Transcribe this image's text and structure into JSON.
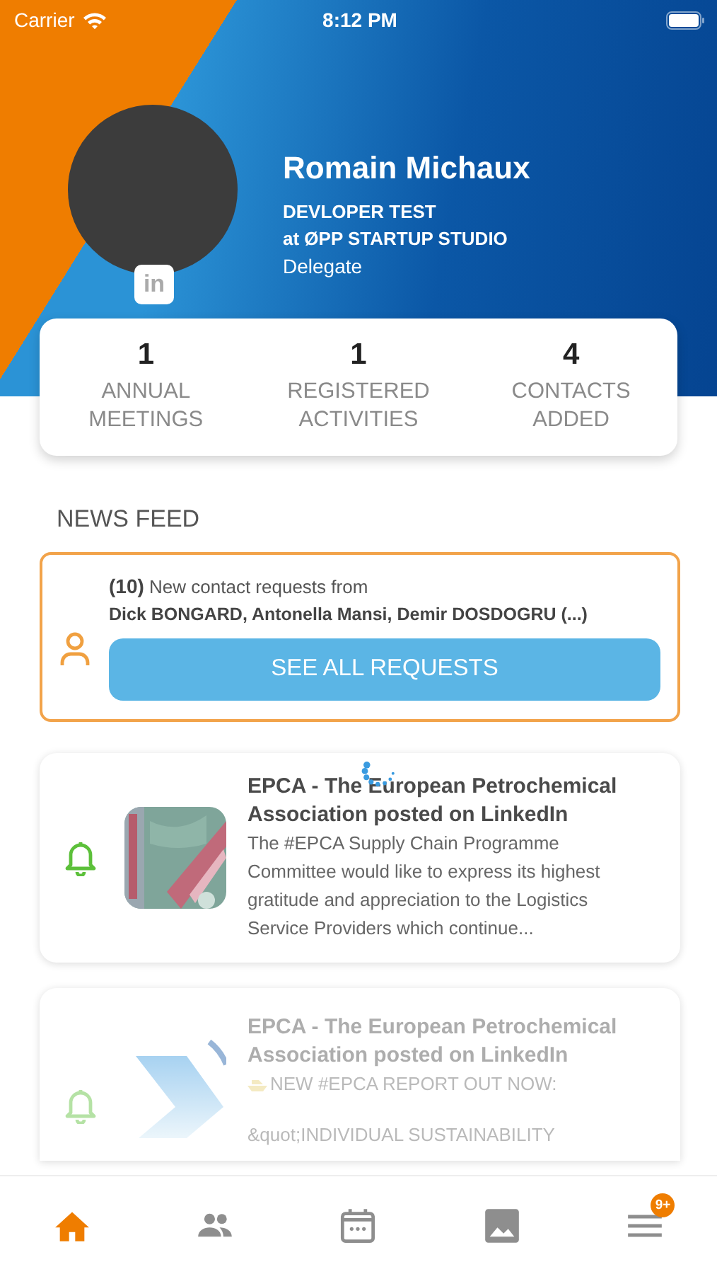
{
  "status_bar": {
    "carrier": "Carrier",
    "time": "8:12 PM"
  },
  "profile": {
    "name": "Romain Michaux",
    "job_title": "DEVLOPER TEST",
    "company": "at ØPP STARTUP STUDIO",
    "role": "Delegate",
    "linkedin": "in"
  },
  "stats": [
    {
      "value": "1",
      "label": "ANNUAL MEETINGS"
    },
    {
      "value": "1",
      "label": "REGISTERED ACTIVITIES"
    },
    {
      "value": "4",
      "label": "CONTACTS ADDED"
    }
  ],
  "news_feed": {
    "title": "NEWS FEED",
    "loading": true,
    "contact_requests": {
      "count": "(10)",
      "text": "New contact requests from",
      "names": "Dick BONGARD, Antonella Mansi, Demir DOSDOGRU (...)",
      "button": "SEE ALL REQUESTS"
    },
    "posts": [
      {
        "faded": false,
        "title": "EPCA - The European Petrochemical Association posted on LinkedIn",
        "lines": [
          "The #EPCA Supply Chain Programme Committee would like to express its highest gratitude and appreciation to the Logistics Service Providers which continue..."
        ]
      },
      {
        "kind": "logo",
        "faded": true,
        "title": "EPCA - The European Petrochemical Association posted on LinkedIn",
        "lines": [
          "NEW #EPCA REPORT OUT NOW:",
          "&quot;INDIVIDUAL SUSTAINABILITY"
        ]
      }
    ]
  },
  "tab_bar": [
    {
      "kind": "home",
      "selected": true
    },
    {
      "kind": "people",
      "selected": false
    },
    {
      "kind": "calendar",
      "selected": false
    },
    {
      "kind": "gallery",
      "selected": false
    },
    {
      "kind": "menu",
      "selected": false,
      "badge": "9+"
    }
  ]
}
